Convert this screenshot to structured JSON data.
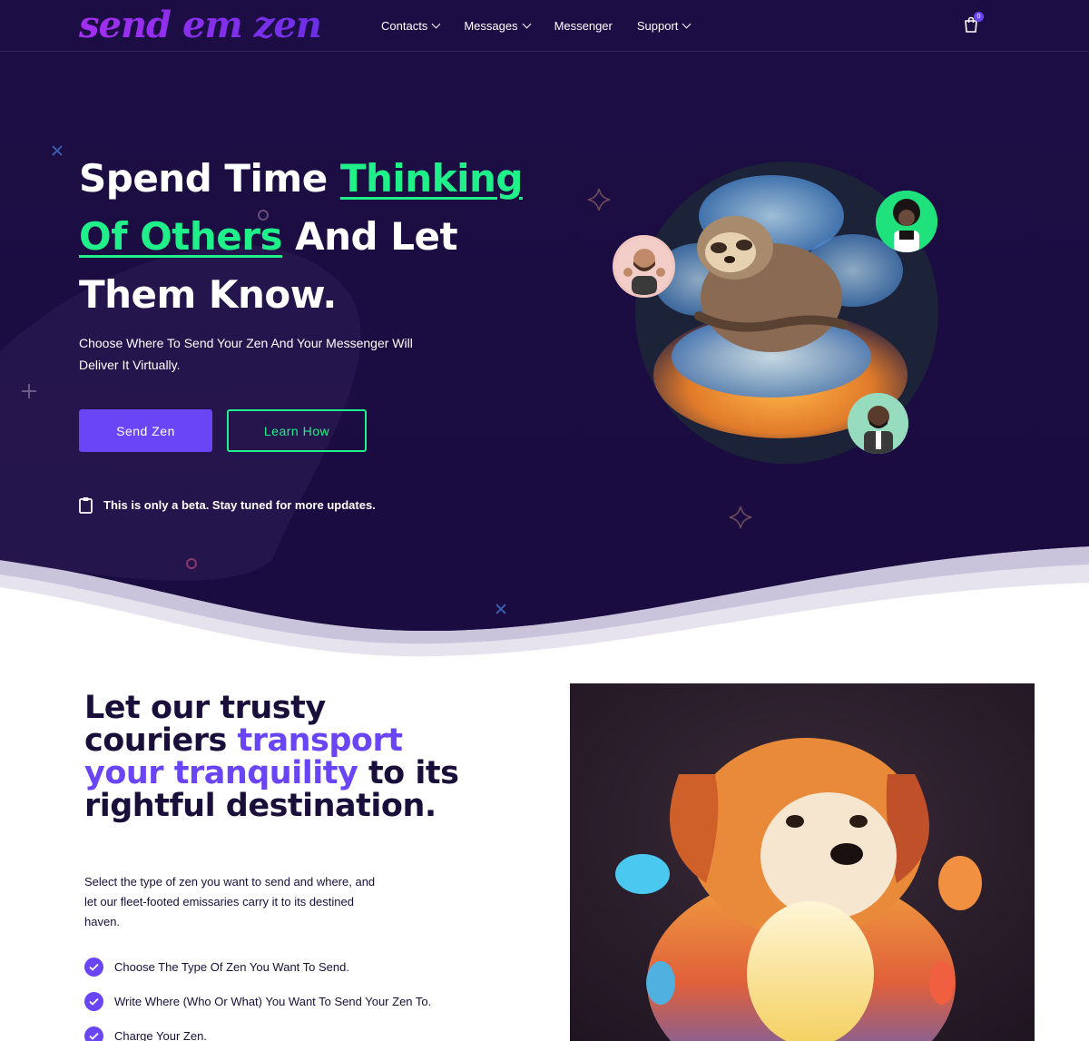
{
  "brand": {
    "logo_text": "send em zen"
  },
  "nav": {
    "items": [
      {
        "label": "Contacts",
        "has_dropdown": true
      },
      {
        "label": "Messages",
        "has_dropdown": true
      },
      {
        "label": "Messenger",
        "has_dropdown": false
      },
      {
        "label": "Support",
        "has_dropdown": true
      }
    ],
    "cart_count": "0"
  },
  "hero": {
    "title_part1": "Spend Time ",
    "title_highlight1": "Thinking",
    "title_highlight2": "Of Others",
    "title_part2": " And Let Them Know.",
    "subtitle": "Choose Where To Send Your Zen And Your Messenger Will Deliver It Virtually.",
    "primary_button": "Send Zen",
    "secondary_button": "Learn How",
    "beta_note": "This is only a beta. Stay tuned for more updates."
  },
  "section2": {
    "title_part1": "Let our trusty couriers ",
    "title_highlight": "transport your tranquility",
    "title_part2": " to its rightful destination.",
    "description": "Select the type of zen you want to send and where, and let our fleet-footed emissaries carry it to its destined haven.",
    "steps": [
      "Choose The Type Of Zen You Want To Send.",
      "Write Where (Who Or What) You Want To Send Your Zen To.",
      "Charge Your Zen."
    ]
  },
  "colors": {
    "hero_bg": "#1c0d44",
    "accent_green": "#20f08a",
    "accent_purple": "#6a45f5",
    "dark_text": "#1a0e3a"
  },
  "icons": [
    "chevron-down-icon",
    "shopping-bag-icon",
    "clipboard-icon",
    "check-icon",
    "cross-icon",
    "plus-icon",
    "sparkle-icon",
    "ring-icon"
  ]
}
